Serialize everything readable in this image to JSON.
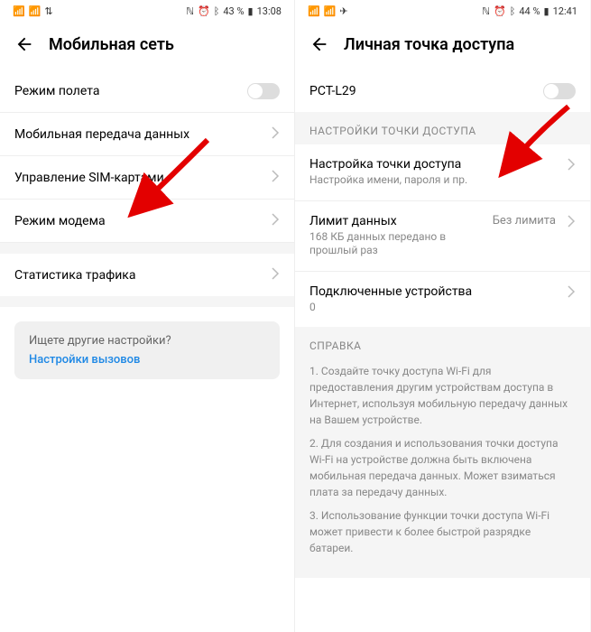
{
  "left": {
    "status": {
      "battery": "43 %",
      "time": "13:08"
    },
    "title": "Мобильная сеть",
    "rows": {
      "airplane": "Режим полета",
      "mobile_data": "Мобильная передача данных",
      "sim": "Управление SIM-картами",
      "tether": "Режим модема",
      "stats": "Статистика трафика"
    },
    "hint": {
      "title": "Ищете другие настройки?",
      "link": "Настройки вызовов"
    }
  },
  "right": {
    "status": {
      "battery": "44 %",
      "time": "12:41"
    },
    "title": "Личная точка доступа",
    "toggle_label": "PCT-L29",
    "section_hotspot": "НАСТРОЙКИ ТОЧКИ ДОСТУПА",
    "rows": {
      "config": {
        "title": "Настройка точки доступа",
        "sub": "Настройка имени, пароля и пр."
      },
      "limit": {
        "title": "Лимит данных",
        "sub": "168 КБ данных передано в прошлый раз",
        "value": "Без лимита"
      },
      "devices": {
        "title": "Подключенные устройства",
        "value": "0"
      }
    },
    "section_help": "СПРАВКА",
    "help": {
      "p1": "1. Создайте точку доступа Wi-Fi для предоставления другим устройствам доступа в Интернет, используя мобильную передачу данных на Вашем устройстве.",
      "p2": "2. Для создания и использования точки доступа Wi-Fi на устройстве должна быть включена мобильная передача данных. Может взиматься плата за передачу данных.",
      "p3": "3. Использование функции точки доступа Wi-Fi может привести к более быстрой разрядке батареи."
    }
  }
}
